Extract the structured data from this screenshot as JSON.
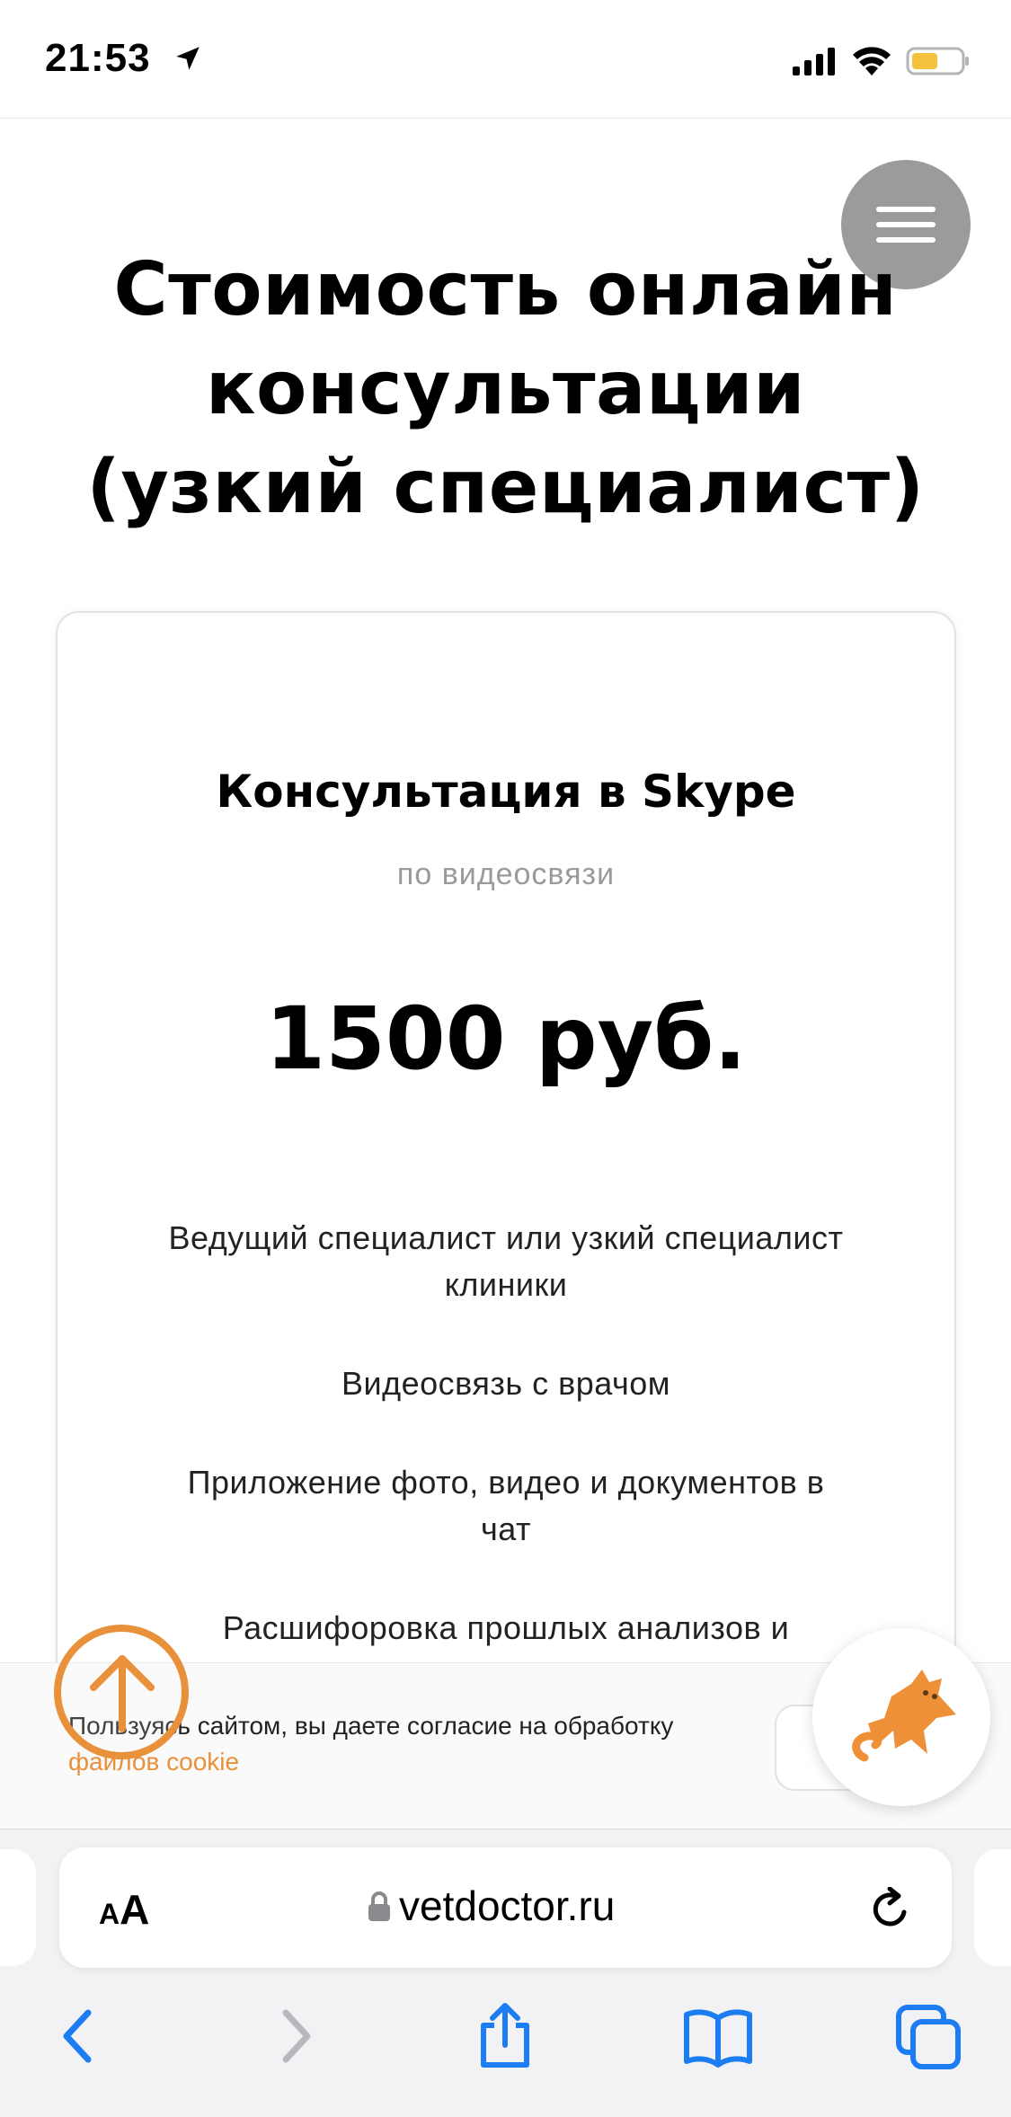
{
  "status_bar": {
    "time": "21:53"
  },
  "page": {
    "title_lines": [
      "Стоимость онлайн",
      "консультации",
      "(узкий специалист)"
    ]
  },
  "card": {
    "title": "Консультация в Skype",
    "subtitle": "по видеосвязи",
    "price": "1500 руб.",
    "features": [
      "Ведущий специалист или узкий специалист клиники",
      "Видеосвязь с врачом",
      "Приложение фото, видео и документов в чат",
      "Расшифоровка прошлых анализов и"
    ]
  },
  "cookie": {
    "text": "Пользуясь сайтом, вы даете согласие на обработку",
    "link": "файлов cookie"
  },
  "browser": {
    "aa_small": "A",
    "aa_large": "A",
    "url": "vetdoctor.ru"
  },
  "colors": {
    "accent_orange": "#e8913a",
    "menu_gray": "#9b9b9b",
    "ios_blue": "#1c7cf2"
  }
}
